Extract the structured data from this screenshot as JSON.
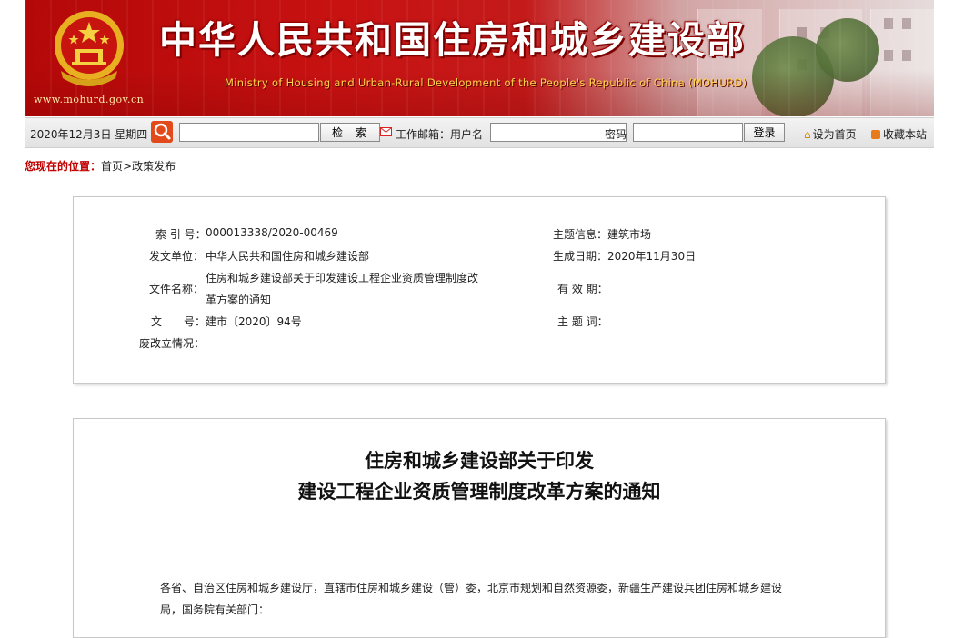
{
  "banner": {
    "site_url": "www.mohurd.gov.cn",
    "title": "中华人民共和国住房和城乡建设部",
    "subtitle": "Ministry of Housing and Urban-Rural Development of the People's Republic of China (MOHURD)"
  },
  "toolbar": {
    "date": "2020年12月3日 星期四",
    "search_button": "检索",
    "mail_label": "工作邮箱：用户名",
    "password_label": "密码",
    "login_button": "登录",
    "set_home": "设为首页",
    "bookmark": "收藏本站"
  },
  "breadcrumb": {
    "prefix": "您现在的位置：",
    "items": [
      "首页",
      "政策发布"
    ],
    "separator": ">"
  },
  "info": {
    "index_label": "索 引 号：",
    "index_value": "000013338/2020-00469",
    "issuer_label": "发文单位：",
    "issuer_value": "中华人民共和国住房和城乡建设部",
    "filename_label": "文件名称：",
    "filename_line1": "住房和城乡建设部关于印发建设工程企业资质管理制度改",
    "filename_line2": "革方案的通知",
    "docno_label": "文　　号：",
    "docno_value": "建市〔2020〕94号",
    "abolish_label": "废改立情况：",
    "topic_label": "主题信息：",
    "topic_value": "建筑市场",
    "date_label": "生成日期：",
    "date_value": "2020年11月30日",
    "validity_label": "有 效 期：",
    "subject_label": "主 题 词："
  },
  "document": {
    "title_line1": "住房和城乡建设部关于印发",
    "title_line2": "建设工程企业资质管理制度改革方案的通知",
    "body_line1": "各省、自治区住房和城乡建设厅，直辖市住房和城乡建设（管）委，北京市规划和自然资源委，新疆生产建设兵团住房和城乡建设",
    "body_line2": "局，国务院有关部门："
  },
  "colors": {
    "banner_red": "#c81212",
    "subtitle_gold": "#ffd54a",
    "breadcrumb_red": "#c00000"
  }
}
